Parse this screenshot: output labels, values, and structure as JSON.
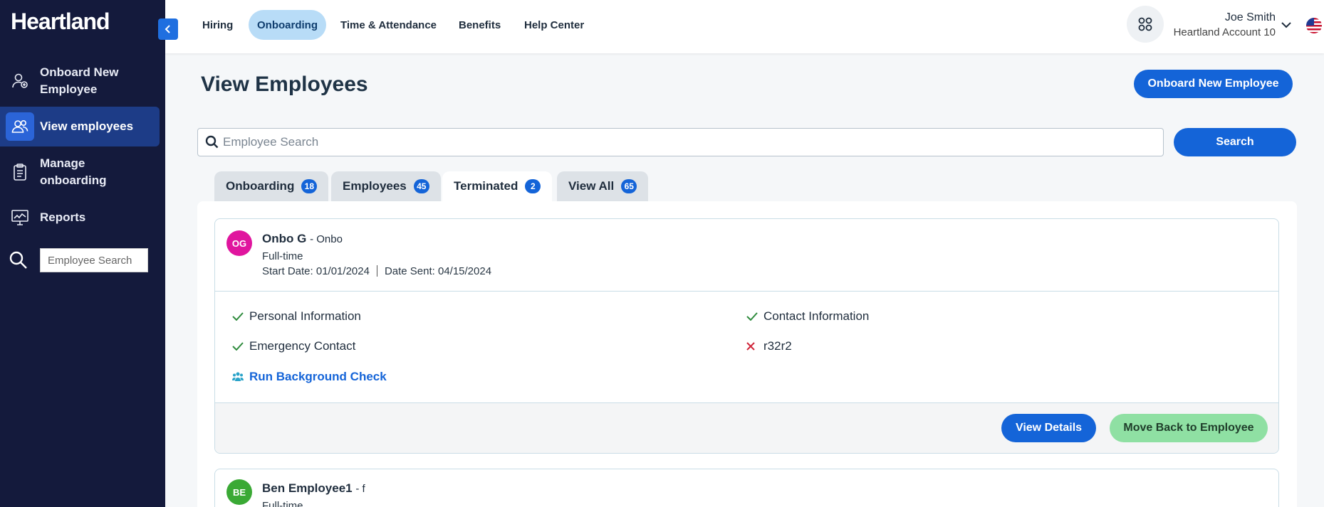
{
  "app": {
    "logo": "Heartland"
  },
  "sidebar": {
    "items": [
      {
        "label": "Onboard New Employee",
        "icon": "user-add-icon"
      },
      {
        "label": "View employees",
        "icon": "users-icon",
        "active": true
      },
      {
        "label": "Manage onboarding",
        "icon": "clipboard-icon"
      },
      {
        "label": "Reports",
        "icon": "chart-board-icon"
      }
    ],
    "search_placeholder": "Employee Search"
  },
  "topnav": {
    "tabs": [
      "Hiring",
      "Onboarding",
      "Time & Attendance",
      "Benefits",
      "Help Center"
    ],
    "active_tab": "Onboarding",
    "user_name": "Joe Smith",
    "account": "Heartland Account 10"
  },
  "main": {
    "title": "View Employees",
    "onboard_button": "Onboard New Employee",
    "search_placeholder": "Employee Search",
    "search_button": "Search",
    "tabs": [
      {
        "label": "Onboarding",
        "count": "18"
      },
      {
        "label": "Employees",
        "count": "45"
      },
      {
        "label": "Terminated",
        "count": "2",
        "active": true
      },
      {
        "label": "View All",
        "count": "65"
      }
    ]
  },
  "employees": [
    {
      "initials": "OG",
      "avatar_color": "#e0159e",
      "name": "Onbo G",
      "suffix": "- Onbo",
      "type": "Full-time",
      "start_date": "Start Date: 01/01/2024",
      "date_sent": "Date Sent: 04/15/2024",
      "checks": [
        {
          "label": "Personal Information",
          "status": "done"
        },
        {
          "label": "Contact Information",
          "status": "done"
        },
        {
          "label": "Emergency Contact",
          "status": "done"
        },
        {
          "label": "r32r2",
          "status": "missing"
        }
      ],
      "background_check": "Run Background Check",
      "view_details": "View Details",
      "move_back": "Move Back to Employee"
    },
    {
      "initials": "BE",
      "avatar_color": "#3aa935",
      "name": "Ben Employee1",
      "suffix": "- f",
      "type": "Full-time"
    }
  ],
  "colors": {
    "sidebar_bg": "#141a3c",
    "primary": "#1464d8",
    "check_green": "#2e8b3d",
    "cross_red": "#d0263a",
    "move_back_bg": "#8fe0a3"
  }
}
